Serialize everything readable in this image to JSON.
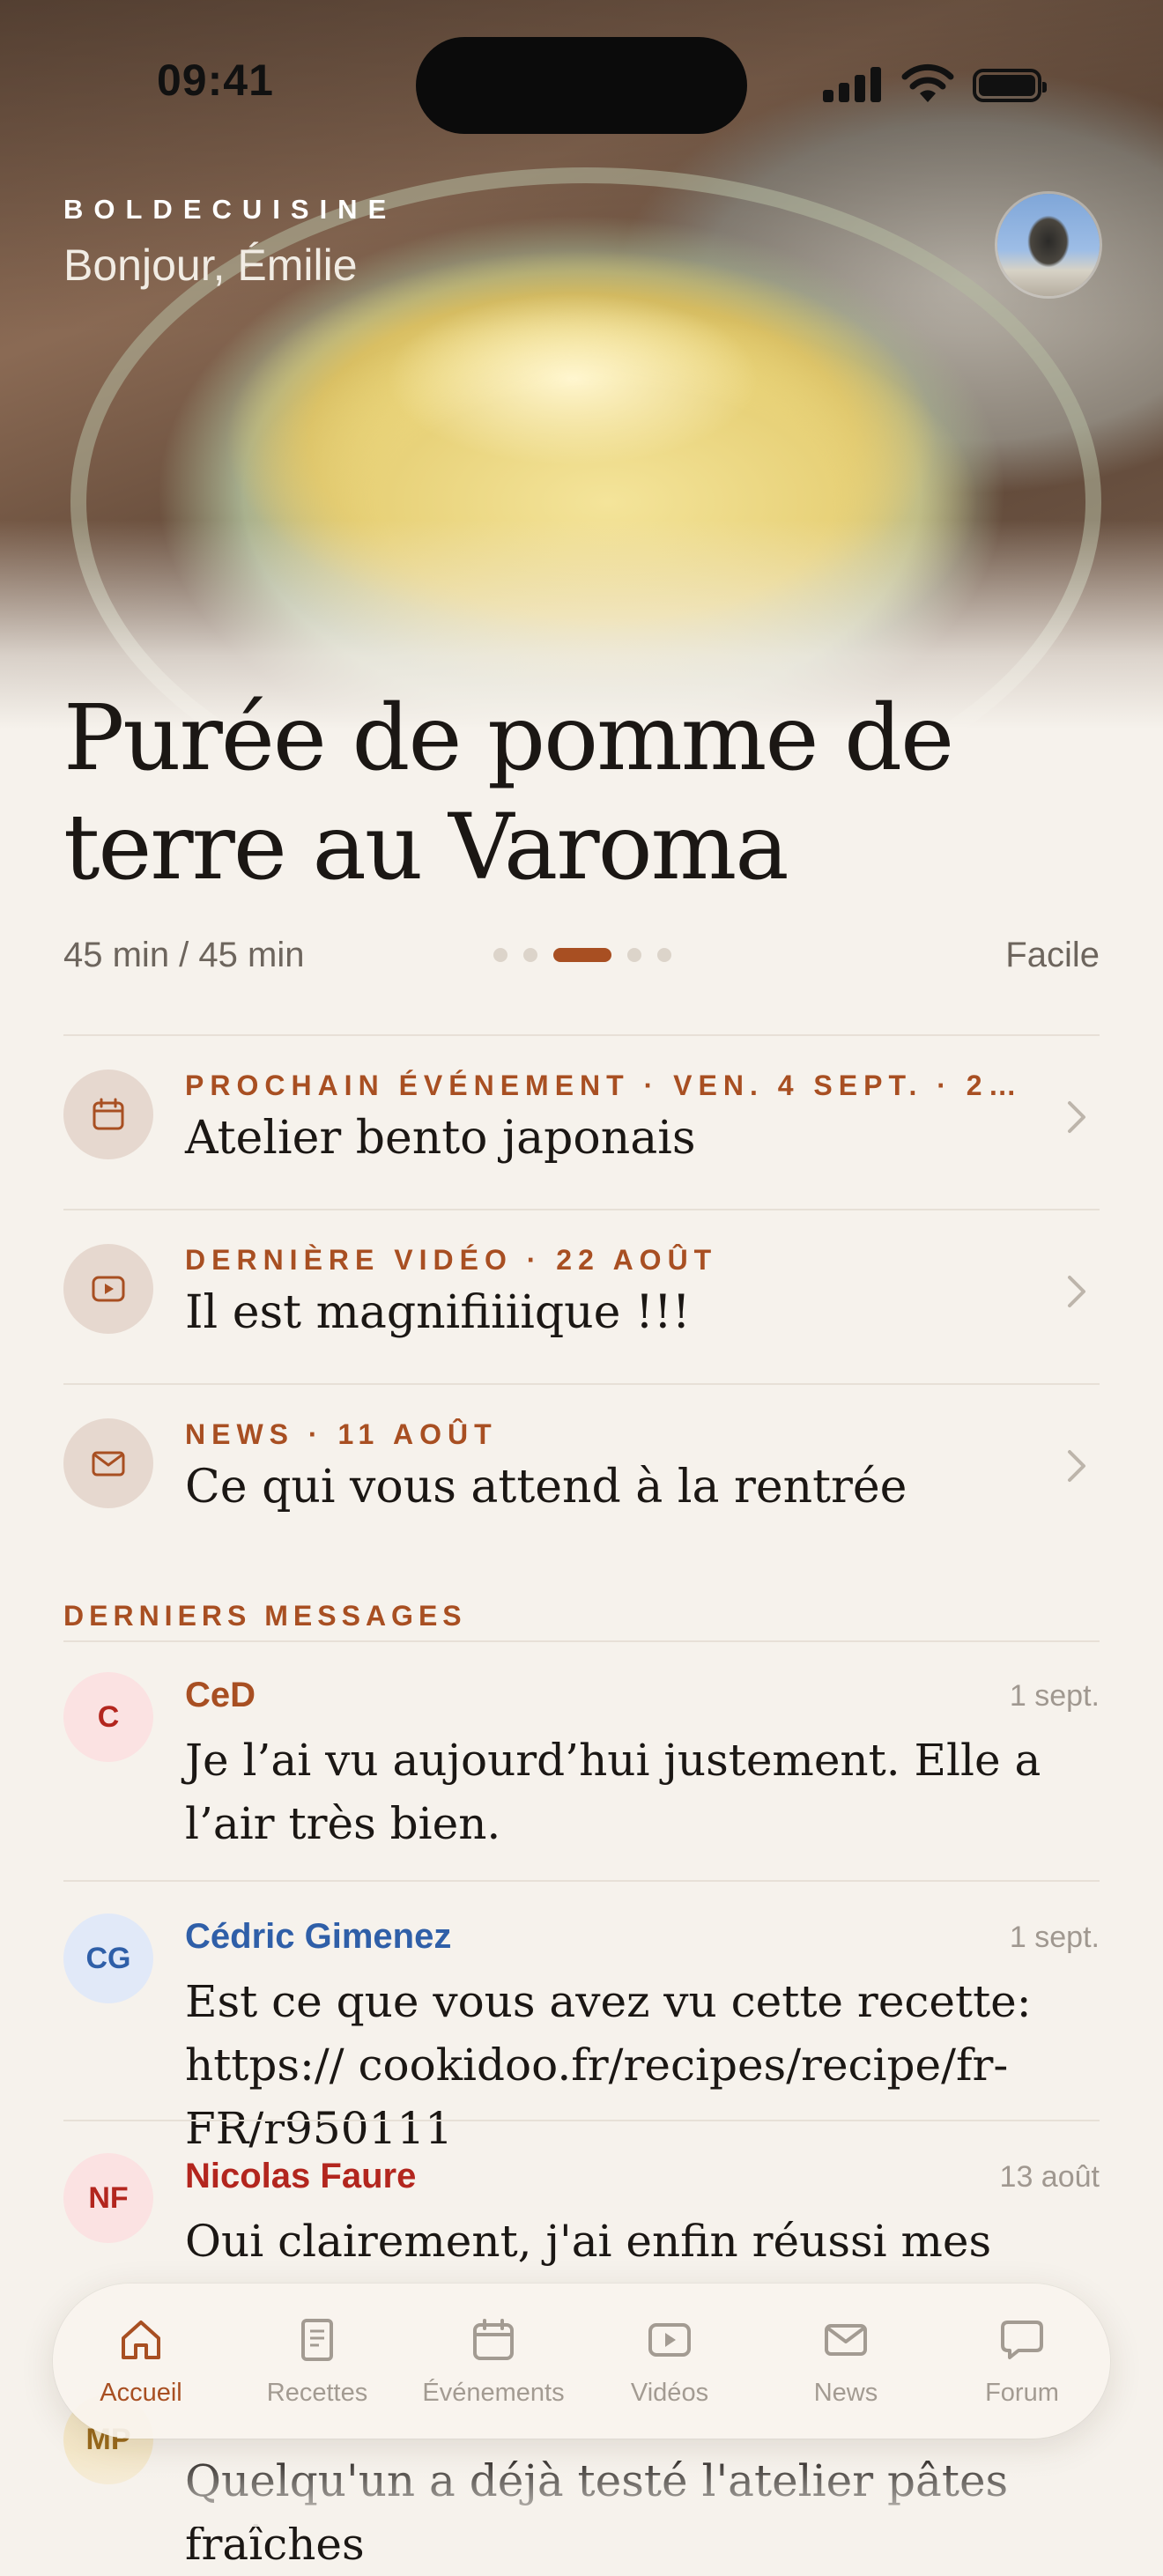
{
  "status": {
    "time": "09:41"
  },
  "header": {
    "brand": "BOLDECUISINE",
    "greeting": "Bonjour, Émilie"
  },
  "hero": {
    "title": "Purée de pomme de terre au Varoma",
    "time": "45 min / 45 min",
    "difficulty": "Facile",
    "carousel_count": 5,
    "carousel_active_index": 2
  },
  "features": [
    {
      "icon": "calendar-icon",
      "kicker": "PROCHAIN ÉVÉNEMENT · VEN. 4 SEPT. · 2…",
      "headline": "Atelier bento japonais"
    },
    {
      "icon": "play-video-icon",
      "kicker": "DERNIÈRE VIDÉO · 22 AOÛT",
      "headline": "Il est magnifiiiique !!!"
    },
    {
      "icon": "envelope-icon",
      "kicker": "NEWS · 11 AOÛT",
      "headline": "Ce qui vous attend à la rentrée"
    }
  ],
  "messages_section": {
    "label": "DERNIERS MESSAGES"
  },
  "messages": [
    {
      "initials": "C",
      "author": "CeD",
      "date": "1 sept.",
      "body": "Je l’ai vu aujourd’hui justement. Elle a l’air très bien.",
      "color": "#b3261e",
      "bg": "#fbe2e2"
    },
    {
      "initials": "CG",
      "author": "Cédric Gimenez",
      "date": "1 sept.",
      "body": "Est ce que vous avez vu cette recette: https:// cookidoo.fr/recipes/recipe/fr-FR/r950111",
      "color": "#2f5fa8",
      "bg": "#e1e9f8"
    },
    {
      "initials": "NF",
      "author": "Nicolas Faure",
      "date": "13 août",
      "body": "Oui clairement, j'ai enfin réussi mes",
      "color": "#b3261e",
      "bg": "#fbe2e2"
    },
    {
      "initials": "MP",
      "author": "",
      "date": "",
      "body": "Quelqu'un a déjà testé l'atelier pâtes fraîches",
      "color": "#9a6a1c",
      "bg": "#f4e7c8"
    }
  ],
  "tabs": [
    {
      "label": "Accueil",
      "icon": "home-icon",
      "active": true
    },
    {
      "label": "Recettes",
      "icon": "recipe-book-icon",
      "active": false
    },
    {
      "label": "Événements",
      "icon": "calendar-icon",
      "active": false
    },
    {
      "label": "Vidéos",
      "icon": "play-video-icon",
      "active": false
    },
    {
      "label": "News",
      "icon": "envelope-icon",
      "active": false
    },
    {
      "label": "Forum",
      "icon": "chat-bubble-icon",
      "active": false
    }
  ],
  "colors": {
    "accent": "#a84f22",
    "background": "#f6f2ec",
    "muted": "#a39b92"
  }
}
